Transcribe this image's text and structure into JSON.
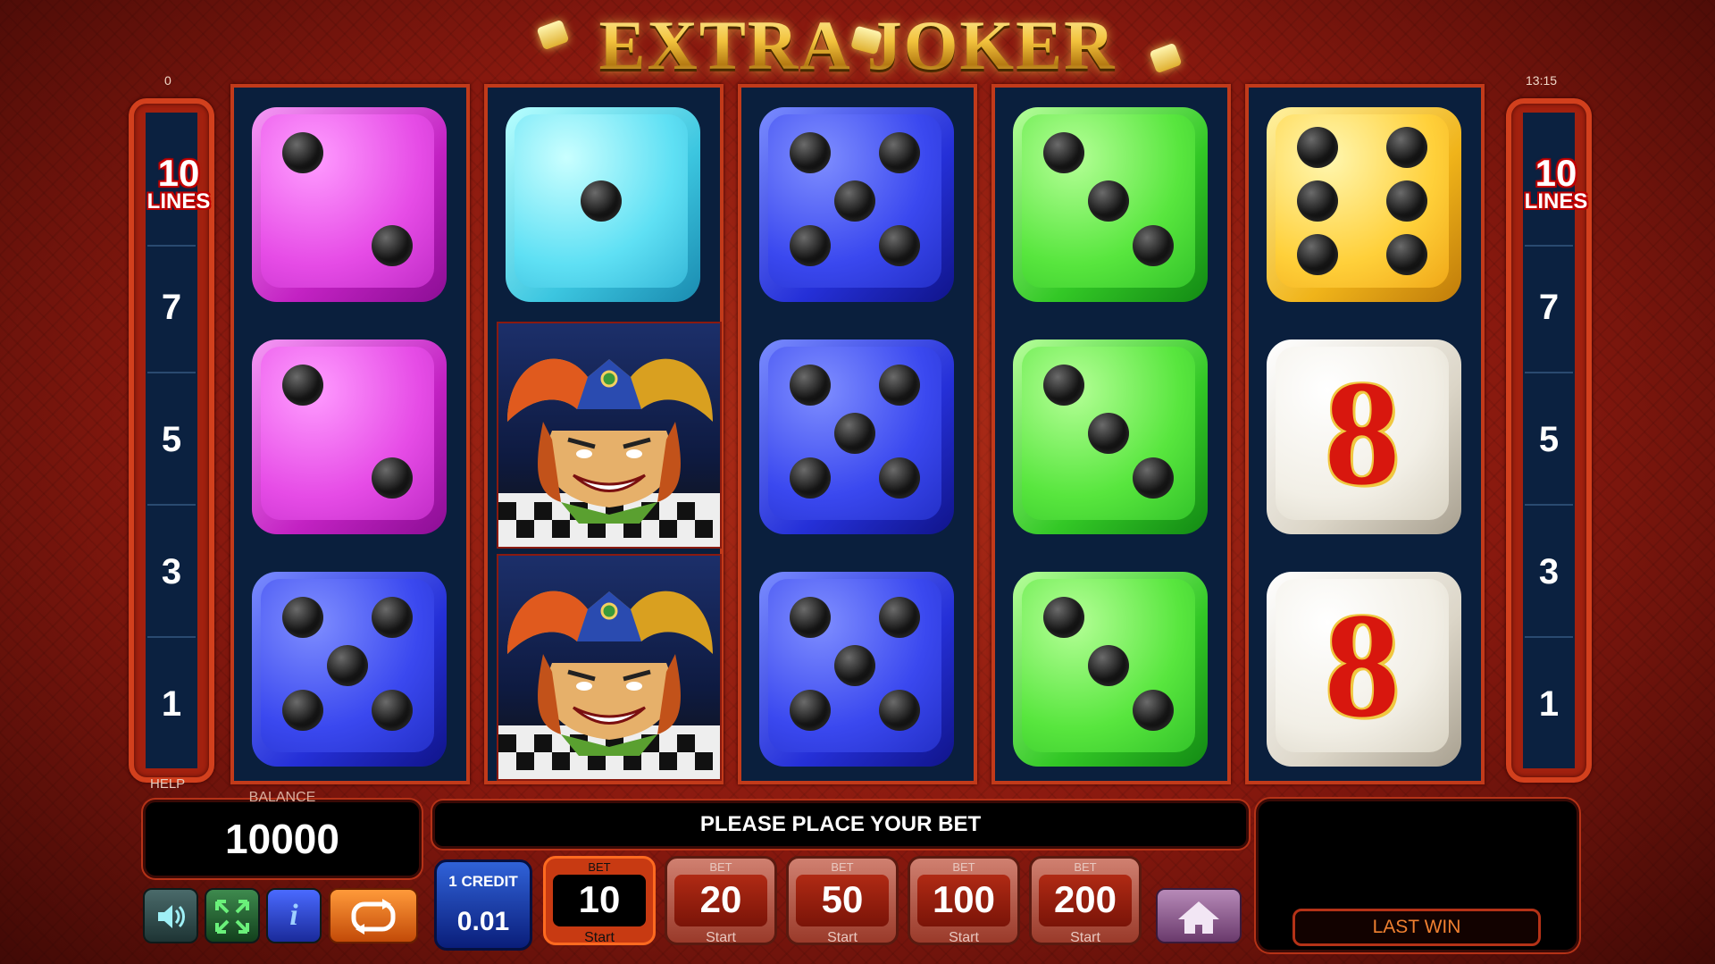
{
  "title": "EXTRA JOKER",
  "top_left_counter": "0",
  "clock": "13:15",
  "lines": {
    "count": "10",
    "label": "LINES",
    "numbers": [
      "7",
      "5",
      "3",
      "1"
    ]
  },
  "reels": [
    [
      "pink-2",
      "pink-2",
      "blue-5"
    ],
    [
      "cyan-1",
      "joker",
      "joker"
    ],
    [
      "blue-5",
      "blue-5",
      "blue-5"
    ],
    [
      "green-3",
      "green-3",
      "green-3"
    ],
    [
      "yellow-6",
      "white-8",
      "white-8"
    ]
  ],
  "symbol_eight": "8",
  "help_label": "HELP",
  "balance": {
    "label": "BALANCE",
    "value": "10000"
  },
  "message": "PLEASE PLACE YOUR BET",
  "last_win_label": "LAST WIN",
  "controls": {
    "sound_icon": "speaker-icon",
    "fullscreen_icon": "fullscreen-icon",
    "info_icon": "info-icon",
    "autoplay_icon": "autoplay-icon",
    "home_icon": "home-icon"
  },
  "credit": {
    "label": "1 CREDIT",
    "value": "0.01"
  },
  "bets": [
    {
      "label": "BET",
      "value": "10",
      "start": "Start",
      "active": true
    },
    {
      "label": "BET",
      "value": "20",
      "start": "Start",
      "active": false
    },
    {
      "label": "BET",
      "value": "50",
      "start": "Start",
      "active": false
    },
    {
      "label": "BET",
      "value": "100",
      "start": "Start",
      "active": false
    },
    {
      "label": "BET",
      "value": "200",
      "start": "Start",
      "active": false
    }
  ],
  "colors": {
    "background": "#8d1a10",
    "reel_bg": "#0a1f3d",
    "frame": "#c23a1a",
    "title_gold": "#f2c23c"
  }
}
